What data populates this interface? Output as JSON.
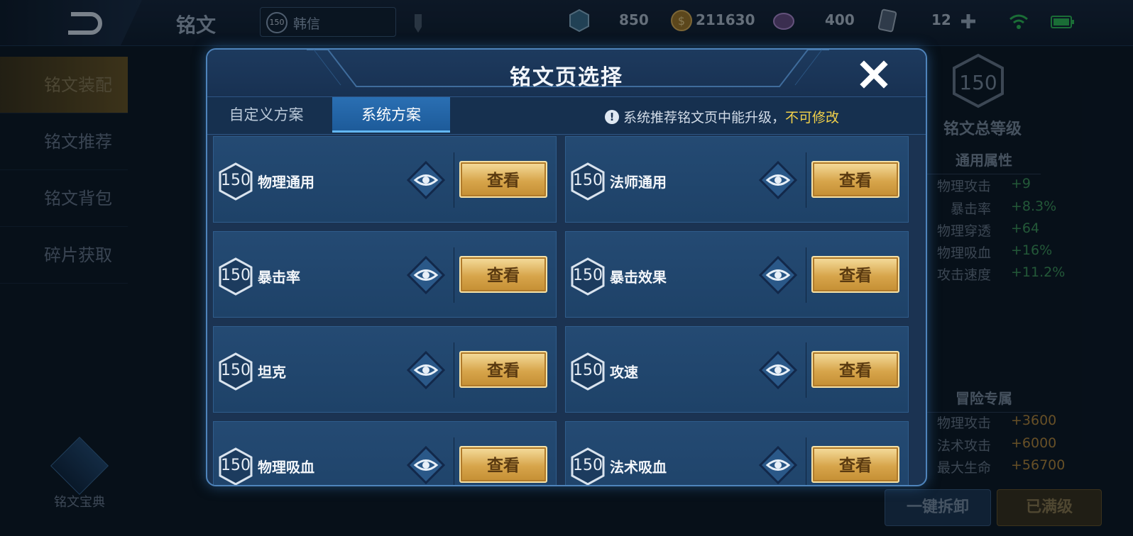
{
  "topbar": {
    "title": "铭文",
    "hero_level": "150",
    "hero_name": "韩信",
    "resources": [
      {
        "icon": "crystal-icon",
        "value": "850"
      },
      {
        "icon": "gold-coin-icon",
        "value": "211630"
      },
      {
        "icon": "gem-icon",
        "value": "400"
      },
      {
        "icon": "card-icon",
        "value": "12"
      }
    ]
  },
  "sidebar": {
    "items": [
      {
        "label": "铭文装配"
      },
      {
        "label": "铭文推荐"
      },
      {
        "label": "铭文背包"
      },
      {
        "label": "碎片获取"
      }
    ],
    "codex_label": "铭文宝典"
  },
  "right_panel": {
    "level": "150",
    "total_label": "铭文总等级",
    "general_title": "通用属性",
    "general_stats": [
      {
        "name": "物理攻击",
        "value": "+9"
      },
      {
        "name": "暴击率",
        "value": "+8.3%"
      },
      {
        "name": "物理穿透",
        "value": "+64"
      },
      {
        "name": "物理吸血",
        "value": "+16%"
      },
      {
        "name": "攻击速度",
        "value": "+11.2%"
      }
    ],
    "adventure_title": "冒险专属",
    "adventure_stats": [
      {
        "name": "物理攻击",
        "value": "+3600"
      },
      {
        "name": "法术攻击",
        "value": "+6000"
      },
      {
        "name": "最大生命",
        "value": "+56700"
      }
    ],
    "unequip_label": "一键拆卸",
    "maxed_label": "已满级"
  },
  "modal": {
    "title": "铭文页选择",
    "tabs": [
      {
        "label": "自定义方案"
      },
      {
        "label": "系统方案"
      }
    ],
    "notice_text": "系统推荐铭文页中能升级，",
    "notice_highlight": "不可修改",
    "view_label": "查看",
    "pages": [
      {
        "level": "150",
        "name": "物理通用"
      },
      {
        "level": "150",
        "name": "法师通用"
      },
      {
        "level": "150",
        "name": "暴击率"
      },
      {
        "level": "150",
        "name": "暴击效果"
      },
      {
        "level": "150",
        "name": "坦克"
      },
      {
        "level": "150",
        "name": "攻速"
      },
      {
        "level": "150",
        "name": "物理吸血"
      },
      {
        "level": "150",
        "name": "法术吸血"
      }
    ]
  },
  "colors": {
    "accent_gold": "#d7a54b",
    "highlight_yellow": "#f3d24a",
    "stat_green": "#3f9a5a",
    "stat_orange": "#b9893a"
  }
}
